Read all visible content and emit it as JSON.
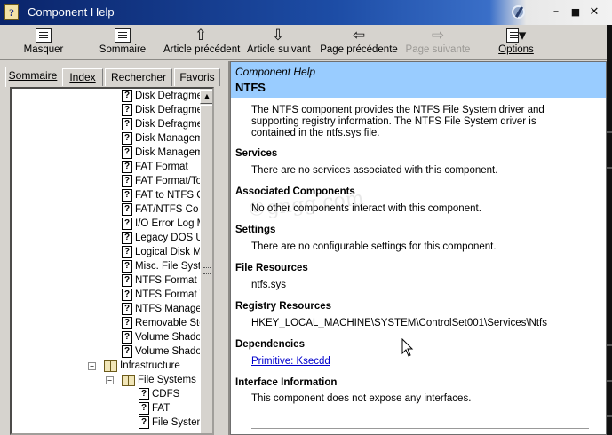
{
  "window": {
    "title": "Component Help"
  },
  "toolbar": [
    {
      "id": "masquer",
      "label": "Masquer",
      "icon": "hide-icon",
      "enabled": true
    },
    {
      "id": "sommaire",
      "label": "Sommaire",
      "icon": "contents-icon",
      "enabled": true
    },
    {
      "id": "article-precedent",
      "label": "Article précédent",
      "icon": "up-arrow-icon",
      "enabled": true
    },
    {
      "id": "article-suivant",
      "label": "Article suivant",
      "icon": "down-arrow-icon",
      "enabled": true
    },
    {
      "id": "page-precedente",
      "label": "Page précédente",
      "icon": "back-arrow-icon",
      "enabled": true
    },
    {
      "id": "page-suivante",
      "label": "Page suivante",
      "icon": "forward-arrow-icon",
      "enabled": false
    },
    {
      "id": "options",
      "label": "Options",
      "icon": "options-icon",
      "enabled": true
    }
  ],
  "tabs": [
    "Sommaire",
    "Index",
    "Rechercher",
    "Favoris"
  ],
  "tree": [
    {
      "label": "Disk Defragme",
      "type": "topic",
      "level": 2
    },
    {
      "label": "Disk Defragme",
      "type": "topic",
      "level": 2
    },
    {
      "label": "Disk Defragme",
      "type": "topic",
      "level": 2
    },
    {
      "label": "Disk Managem",
      "type": "topic",
      "level": 2
    },
    {
      "label": "Disk Managem",
      "type": "topic",
      "level": 2
    },
    {
      "label": "FAT Format",
      "type": "topic",
      "level": 2
    },
    {
      "label": "FAT Format/To",
      "type": "topic",
      "level": 2
    },
    {
      "label": "FAT to NTFS C",
      "type": "topic",
      "level": 2
    },
    {
      "label": "FAT/NTFS Co",
      "type": "topic",
      "level": 2
    },
    {
      "label": "I/O Error Log M",
      "type": "topic",
      "level": 2
    },
    {
      "label": "Legacy DOS U",
      "type": "topic",
      "level": 2
    },
    {
      "label": "Logical Disk M",
      "type": "topic",
      "level": 2
    },
    {
      "label": "Misc. File Syste",
      "type": "topic",
      "level": 2
    },
    {
      "label": "NTFS Format",
      "type": "topic",
      "level": 2
    },
    {
      "label": "NTFS Format T",
      "type": "topic",
      "level": 2
    },
    {
      "label": "NTFS Manage",
      "type": "topic",
      "level": 2
    },
    {
      "label": "Removable Sto",
      "type": "topic",
      "level": 2
    },
    {
      "label": "Volume Shado",
      "type": "topic",
      "level": 2
    },
    {
      "label": "Volume Shado",
      "type": "topic",
      "level": 2
    },
    {
      "label": "Infrastructure",
      "type": "book",
      "level": 0
    },
    {
      "label": "File Systems",
      "type": "book",
      "level": 1
    },
    {
      "label": "CDFS",
      "type": "topic",
      "level": 3
    },
    {
      "label": "FAT",
      "type": "topic",
      "level": 3
    },
    {
      "label": "File System",
      "type": "topic",
      "level": 3
    }
  ],
  "content": {
    "header_sub": "Component Help",
    "header_title": "NTFS",
    "intro_lines": [
      "The NTFS component provides the NTFS File System driver and",
      "supporting registry information. The NTFS File System driver is",
      "contained in the ntfs.sys file."
    ],
    "sections": [
      {
        "heading": "Services",
        "text": "There are no services associated with this component."
      },
      {
        "heading": "Associated Components",
        "text": "No other components interact with this component."
      },
      {
        "heading": "Settings",
        "text": "There are no configurable settings for this component."
      },
      {
        "heading": "File Resources",
        "text": "ntfs.sys"
      },
      {
        "heading": "Registry Resources",
        "text": "HKEY_LOCAL_MACHINE\\SYSTEM\\ControlSet001\\Services\\Ntfs"
      },
      {
        "heading": "Dependencies",
        "link": "Primitive: Ksecdd"
      },
      {
        "heading": "Interface Information",
        "text": "This component does not expose any interfaces."
      }
    ],
    "watermark": "©gngg.com"
  }
}
